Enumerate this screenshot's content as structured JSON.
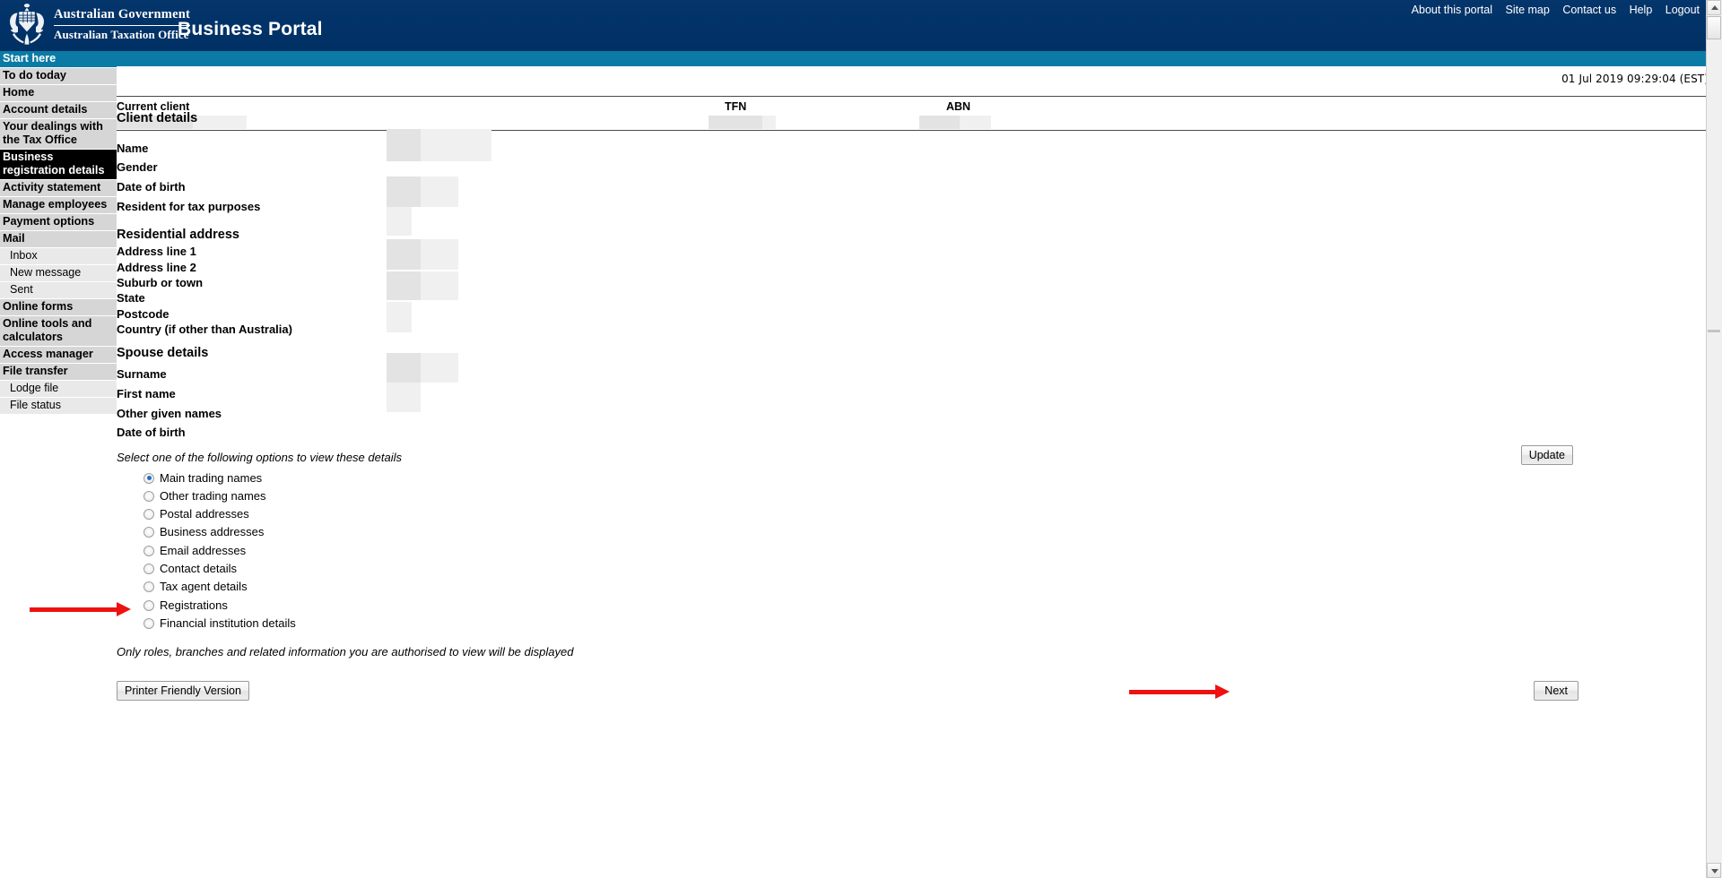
{
  "header": {
    "government_line1": "Australian Government",
    "government_line2": "Australian Taxation Office",
    "portal_title": "Business Portal",
    "crest_icon": "australian-coat-of-arms-icon",
    "top_nav": [
      "About this portal",
      "Site map",
      "Contact us",
      "Help",
      "Logout"
    ]
  },
  "sidebar": {
    "items": [
      {
        "label": "Start here",
        "style": "start"
      },
      {
        "label": "To do today",
        "style": "normal"
      },
      {
        "label": "Home",
        "style": "normal"
      },
      {
        "label": "Account details",
        "style": "normal"
      },
      {
        "label": "Your dealings with the Tax Office",
        "style": "normal"
      },
      {
        "label": "Business registration details",
        "style": "active"
      },
      {
        "label": "Activity statement",
        "style": "normal"
      },
      {
        "label": "Manage employees",
        "style": "normal"
      },
      {
        "label": "Payment options",
        "style": "normal"
      },
      {
        "label": "Mail",
        "style": "normal"
      },
      {
        "label": "Inbox",
        "style": "sub"
      },
      {
        "label": "New message",
        "style": "sub"
      },
      {
        "label": "Sent",
        "style": "sub"
      },
      {
        "label": "Online forms",
        "style": "normal"
      },
      {
        "label": "Online tools and calculators",
        "style": "normal"
      },
      {
        "label": "Access manager",
        "style": "normal"
      },
      {
        "label": "File transfer",
        "style": "normal"
      },
      {
        "label": "Lodge file",
        "style": "sub"
      },
      {
        "label": "File status",
        "style": "sub"
      }
    ]
  },
  "main": {
    "timestamp": "01 Jul 2019 09:29:04 (EST)",
    "client_bar": {
      "current_client_label": "Current client",
      "current_client_value": "",
      "tfn_label": "TFN",
      "tfn_value": "",
      "abn_label": "ABN",
      "abn_value": ""
    },
    "client_details": {
      "title": "Client details",
      "fields": [
        {
          "label": "Name",
          "value": ""
        },
        {
          "label": "Gender",
          "value": ""
        },
        {
          "label": "Date of birth",
          "value": ""
        },
        {
          "label": "Resident for tax purposes",
          "value": ""
        }
      ]
    },
    "residential_address": {
      "title": "Residential address",
      "fields": [
        {
          "label": "Address line 1",
          "value": ""
        },
        {
          "label": "Address line 2",
          "value": ""
        },
        {
          "label": "Suburb or town",
          "value": ""
        },
        {
          "label": "State",
          "value": ""
        },
        {
          "label": "Postcode",
          "value": ""
        },
        {
          "label": "Country (if other than Australia)",
          "value": ""
        }
      ]
    },
    "spouse_details": {
      "title": "Spouse details",
      "fields": [
        {
          "label": "Surname",
          "value": ""
        },
        {
          "label": "First name",
          "value": ""
        },
        {
          "label": "Other given names",
          "value": ""
        },
        {
          "label": "Date of birth",
          "value": ""
        }
      ]
    },
    "options": {
      "note": "Select one of the following options to view these details",
      "selected": "Main trading names",
      "items": [
        {
          "label": "Main trading names",
          "checked": true
        },
        {
          "label": "Other trading names",
          "checked": false
        },
        {
          "label": "Postal addresses",
          "checked": false
        },
        {
          "label": "Business addresses",
          "checked": false
        },
        {
          "label": "Email addresses",
          "checked": false
        },
        {
          "label": "Contact details",
          "checked": false
        },
        {
          "label": "Tax agent details",
          "checked": false
        },
        {
          "label": "Registrations",
          "checked": false
        },
        {
          "label": "Financial institution details",
          "checked": false
        }
      ]
    },
    "auth_note": "Only roles, branches and related information you are authorised to view will be displayed",
    "buttons": {
      "update": "Update",
      "printer_friendly": "Printer Friendly Version",
      "next": "Next"
    }
  },
  "annotations": {
    "arrow_registrations": "red-arrow-pointing-to-registrations-radio",
    "arrow_next": "red-arrow-pointing-to-next-button"
  },
  "colors": {
    "header_navy": "#003366",
    "teal": "#0b7ba5",
    "active_black": "#000000",
    "nav_grey": "#d6d6d6",
    "sub_nav_grey": "#e9e9e9",
    "annotation_red": "#ee1111",
    "radio_blue": "#1d6fc0"
  }
}
